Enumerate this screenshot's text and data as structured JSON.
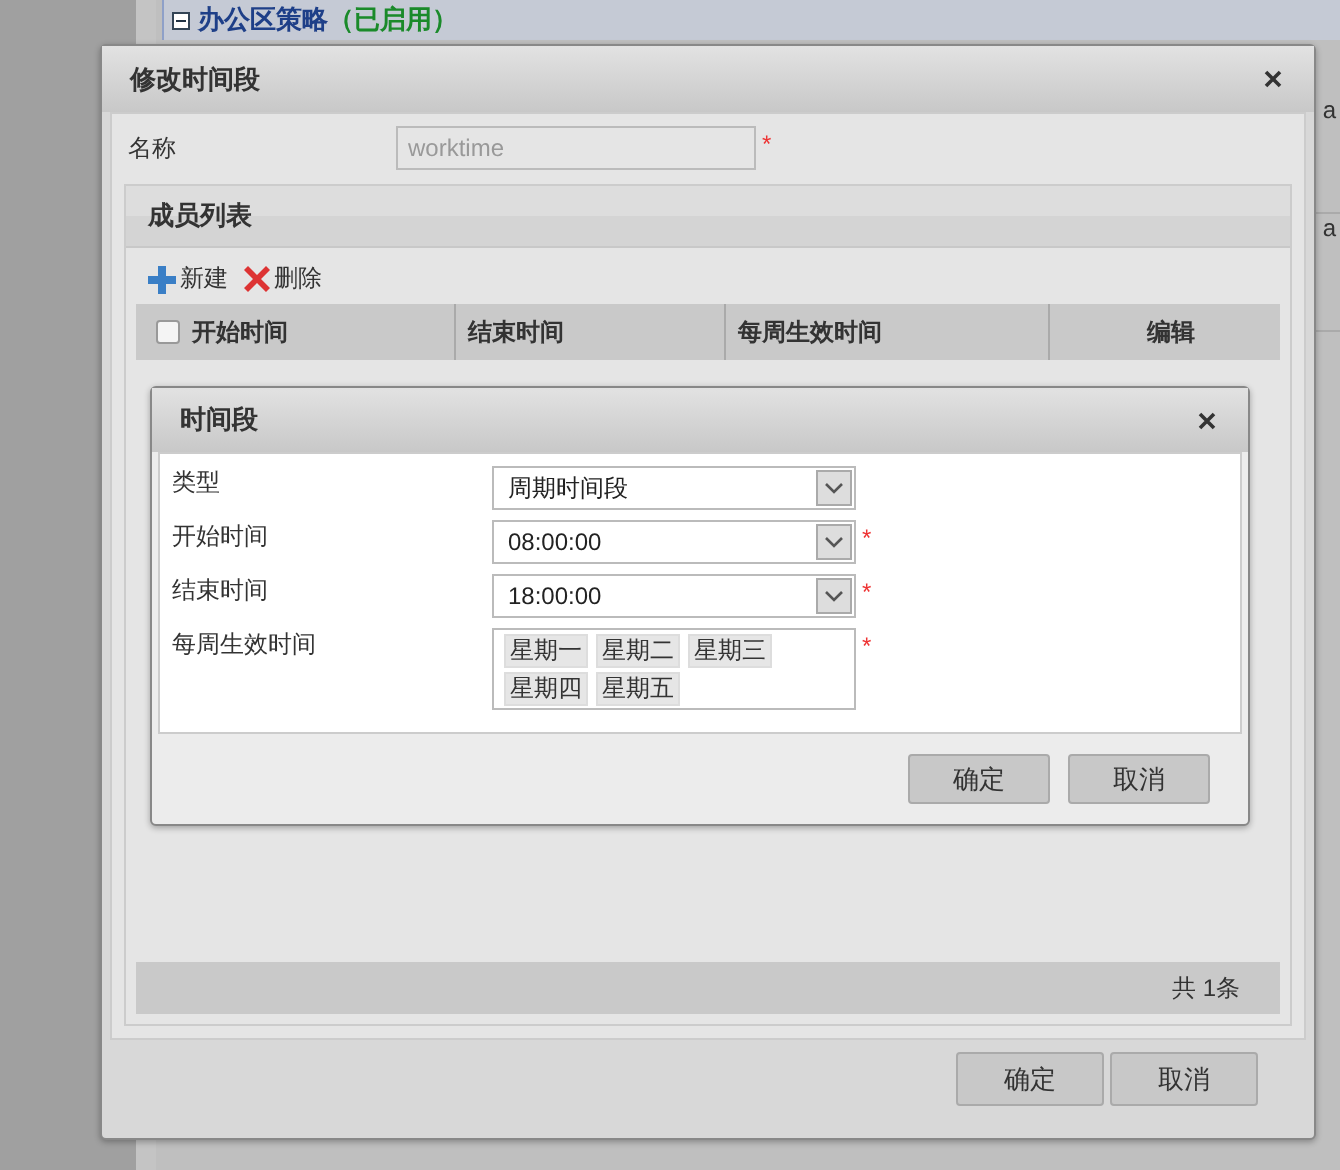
{
  "background": {
    "policy_title": "办公区策略",
    "policy_status": "（已启用）",
    "side_cells": [
      "a",
      "a"
    ]
  },
  "dialog": {
    "title": "修改时间段",
    "name_label": "名称",
    "name_value": "worktime",
    "name_required_mark": "*",
    "member_panel": {
      "title": "成员列表",
      "toolbar": [
        {
          "kind": "add",
          "label": "新建"
        },
        {
          "kind": "delete",
          "label": "删除"
        }
      ],
      "header_checkbox": {
        "checked": false
      },
      "columns": [
        {
          "label": "开始时间"
        },
        {
          "label": "结束时间"
        },
        {
          "label": "每周生效时间"
        },
        {
          "label": "编辑"
        }
      ],
      "footer": "共 1条"
    },
    "buttons": [
      "确定",
      "取消"
    ]
  },
  "subdialog": {
    "title": "时间段",
    "fields": [
      {
        "kind": "select",
        "label": "类型",
        "value": "周期时间段"
      },
      {
        "kind": "select",
        "label": "开始时间",
        "value": "08:00:00",
        "required_mark": "*"
      },
      {
        "kind": "select",
        "label": "结束时间",
        "value": "18:00:00",
        "required_mark": "*"
      },
      {
        "kind": "tags",
        "label": "每周生效时间",
        "tags": [
          "星期一",
          "星期二",
          "星期三",
          "星期四",
          "星期五"
        ],
        "required_mark": "*"
      }
    ],
    "buttons": [
      "确定",
      "取消"
    ]
  }
}
